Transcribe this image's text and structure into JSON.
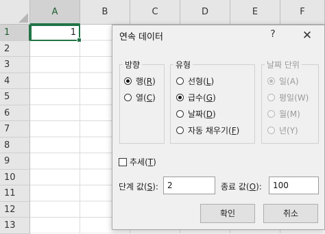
{
  "sheet": {
    "columns": [
      "A",
      "B",
      "C",
      "D",
      "E",
      "F"
    ],
    "rows": [
      "1",
      "2",
      "3",
      "4",
      "5",
      "6",
      "7",
      "8",
      "9",
      "10",
      "11",
      "12",
      "13"
    ],
    "a1_value": "1"
  },
  "dialog": {
    "title": "연속 데이터",
    "help": "?",
    "close": "✕",
    "direction": {
      "legend": "방향",
      "options": [
        {
          "text": "행(",
          "key": "R",
          "suffix": ")",
          "checked": true
        },
        {
          "text": "열(",
          "key": "C",
          "suffix": ")",
          "checked": false
        }
      ]
    },
    "type": {
      "legend": "유형",
      "options": [
        {
          "text": "선형(",
          "key": "L",
          "suffix": ")",
          "checked": false
        },
        {
          "text": "급수(",
          "key": "G",
          "suffix": ")",
          "checked": true
        },
        {
          "text": "날짜(",
          "key": "D",
          "suffix": ")",
          "checked": false
        },
        {
          "text": "자동 채우기(",
          "key": "F",
          "suffix": ")",
          "checked": false
        }
      ]
    },
    "date_unit": {
      "legend": "날짜 단위",
      "options": [
        {
          "text": "일(A)",
          "checked": true
        },
        {
          "text": "평일(W)",
          "checked": false
        },
        {
          "text": "월(M)",
          "checked": false
        },
        {
          "text": "년(Y)",
          "checked": false
        }
      ]
    },
    "trend": {
      "text": "추세(",
      "key": "T",
      "suffix": ")"
    },
    "step": {
      "label_text": "단계 값(",
      "key": "S",
      "label_suffix": "):",
      "value": "2"
    },
    "stop": {
      "label_text": "종료 값(",
      "key": "O",
      "label_suffix": "):",
      "value": "100"
    },
    "ok": "확인",
    "cancel": "취소"
  }
}
